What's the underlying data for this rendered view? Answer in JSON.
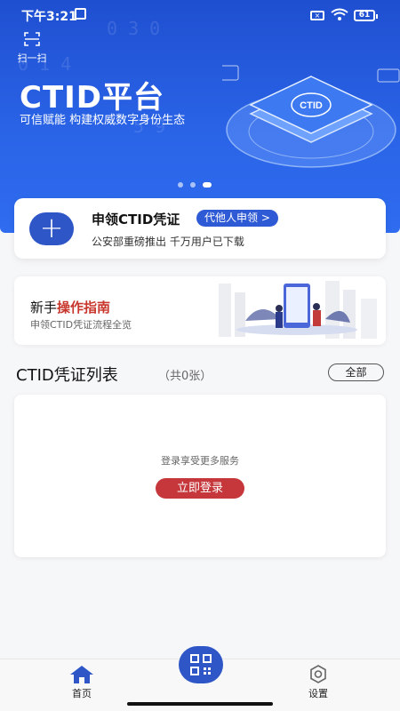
{
  "status_bar": {
    "time": "下午3:21",
    "battery": "61"
  },
  "hero": {
    "scan_label": "扫一扫",
    "title": "CTID平台",
    "subtitle": "可信赋能 构建权威数字身份生态",
    "platform_badge": "CTID",
    "carousel": {
      "count": 3,
      "active_index": 2
    }
  },
  "apply_card": {
    "title": "申领CTID凭证",
    "proxy_button": "代他人申领 >",
    "description": "公安部重磅推出 千万用户已下载"
  },
  "guide": {
    "title_prefix": "新手",
    "title_accent": "操作指南",
    "description": "申领CTID凭证流程全览"
  },
  "credential_list": {
    "title": "CTID凭证列表",
    "count": "（共0张）",
    "filter_button": "全部",
    "empty_text": "登录享受更多服务",
    "login_button": "立即登录"
  },
  "tabbar": {
    "home": "首页",
    "settings": "设置"
  },
  "colors": {
    "brand_blue": "#2e56c7",
    "hero_blue": "#2a63e6",
    "accent_red": "#c5373b"
  }
}
